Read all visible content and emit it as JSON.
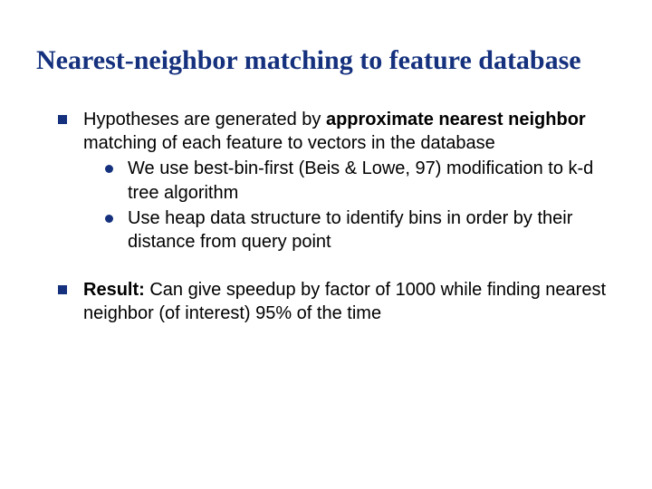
{
  "title": "Nearest-neighbor matching to feature database",
  "bullets": [
    {
      "prefix": "Hypotheses are generated by ",
      "bold": "approximate nearest neighbor",
      "suffix": " matching of each feature to vectors in the database",
      "sub": [
        "We use best-bin-first (Beis & Lowe, 97) modification to k-d tree algorithm",
        "Use heap data structure to identify bins in order by their distance from query point"
      ]
    },
    {
      "bold": "Result:",
      "suffix": " Can give speedup by factor of 1000 while finding nearest neighbor (of interest) 95% of the time"
    }
  ]
}
